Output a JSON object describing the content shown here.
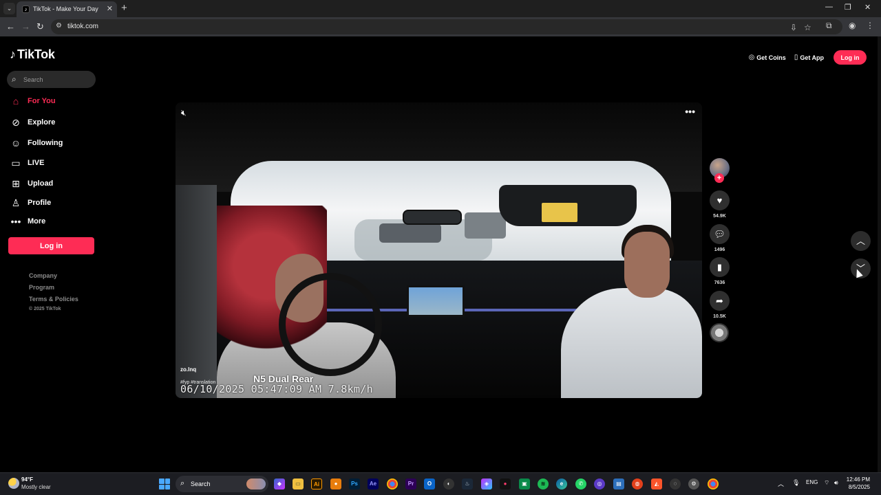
{
  "browser": {
    "tab_title": "TikTok - Make Your Day",
    "url": "tiktok.com"
  },
  "sidebar": {
    "logo_text": "TikTok",
    "search_placeholder": "Search",
    "nav": [
      {
        "label": "For You",
        "icon": "home-icon",
        "active": true
      },
      {
        "label": "Explore",
        "icon": "compass-icon",
        "active": false
      },
      {
        "label": "Following",
        "icon": "following-icon",
        "active": false
      },
      {
        "label": "LIVE",
        "icon": "live-icon",
        "active": false
      },
      {
        "label": "Upload",
        "icon": "upload-icon",
        "active": false
      },
      {
        "label": "Profile",
        "icon": "profile-icon",
        "active": false
      },
      {
        "label": "More",
        "icon": "more-icon",
        "active": false
      }
    ],
    "login_label": "Log in",
    "footer_links": [
      "Company",
      "Program",
      "Terms & Policies"
    ],
    "copyright": "© 2025 TikTok"
  },
  "header": {
    "get_coins": "Get Coins",
    "get_app": "Get App",
    "login": "Log in"
  },
  "video": {
    "author": "zo.lnq",
    "caption": "#fyp #translation",
    "overlay_label": "N5 Dual Rear",
    "timestamp_overlay": "06/10/2025 05:47:09 AM  7.8km/h"
  },
  "actions": {
    "likes": "54.9K",
    "comments": "1496",
    "saves": "7636",
    "shares": "10.5K"
  },
  "colors": {
    "accent": "#fe2c55",
    "background": "#000000"
  },
  "taskbar": {
    "temperature": "94°F",
    "weather": "Mostly clear",
    "search_label": "Search",
    "language": "ENG",
    "time": "12:46 PM",
    "date": "8/5/2025"
  }
}
